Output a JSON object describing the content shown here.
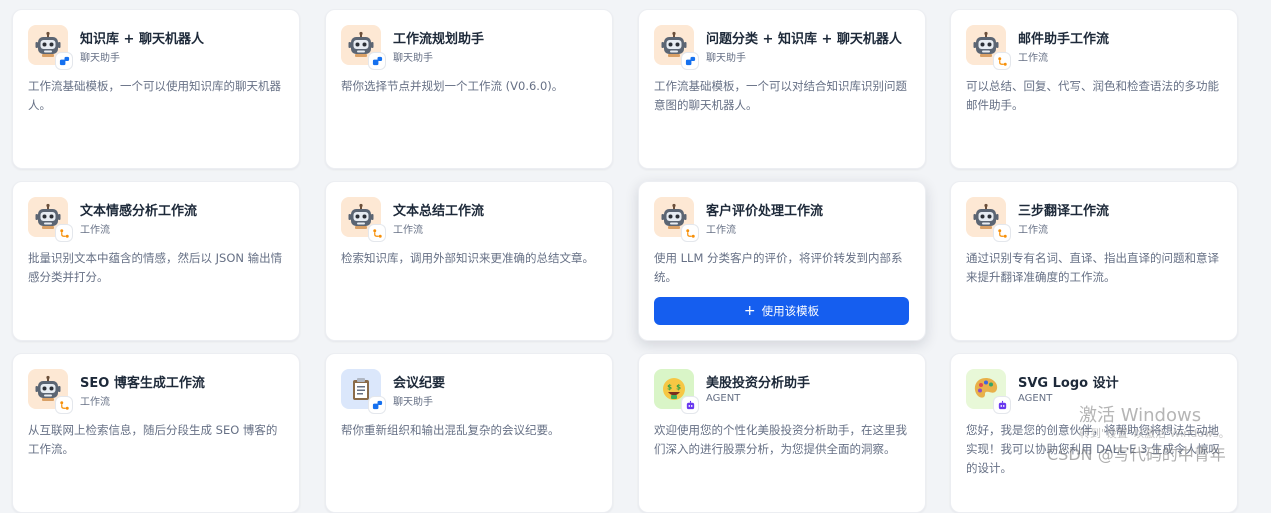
{
  "colors": {
    "page_bg": "#f2f4f7",
    "accent": "#155eef",
    "robot_bg": "#fde8d4",
    "doc_bg": "#dbe7fb",
    "stock_bg": "#d9f5c7",
    "palette_bg": "#e8f8d8"
  },
  "cards": [
    {
      "title": "知识库 + 聊天机器人",
      "subtitle": "聊天助手",
      "desc": "工作流基础模板，一个可以使用知识库的聊天机器人。",
      "icon": "robot-icon",
      "mode_icon": "chat-assistant-icon"
    },
    {
      "title": "工作流规划助手",
      "subtitle": "聊天助手",
      "desc": "帮你选择节点并规划一个工作流 (V0.6.0)。",
      "icon": "robot-icon",
      "mode_icon": "chat-assistant-icon"
    },
    {
      "title": "问题分类 + 知识库 + 聊天机器人",
      "subtitle": "聊天助手",
      "desc": "工作流基础模板，一个可以对结合知识库识别问题意图的聊天机器人。",
      "icon": "robot-icon",
      "mode_icon": "chat-assistant-icon"
    },
    {
      "title": "邮件助手工作流",
      "subtitle": "工作流",
      "desc": "可以总结、回复、代写、润色和检查语法的多功能邮件助手。",
      "icon": "robot-icon",
      "mode_icon": "workflow-icon"
    },
    {
      "title": "文本情感分析工作流",
      "subtitle": "工作流",
      "desc": "批量识别文本中蕴含的情感，然后以 JSON 输出情感分类并打分。",
      "icon": "robot-icon",
      "mode_icon": "workflow-icon"
    },
    {
      "title": "文本总结工作流",
      "subtitle": "工作流",
      "desc": "检索知识库，调用外部知识来更准确的总结文章。",
      "icon": "robot-icon",
      "mode_icon": "workflow-icon"
    },
    {
      "title": "客户评价处理工作流",
      "subtitle": "工作流",
      "desc": "使用 LLM 分类客户的评价，将评价转发到内部系统。",
      "icon": "robot-icon",
      "mode_icon": "workflow-icon",
      "hovered": true,
      "button_label": "使用该模板"
    },
    {
      "title": "三步翻译工作流",
      "subtitle": "工作流",
      "desc": "通过识别专有名词、直译、指出直译的问题和意译来提升翻译准确度的工作流。",
      "icon": "robot-icon",
      "mode_icon": "workflow-icon"
    },
    {
      "title": "SEO 博客生成工作流",
      "subtitle": "工作流",
      "desc": "从互联网上检索信息，随后分段生成 SEO 博客的工作流。",
      "icon": "robot-icon",
      "mode_icon": "workflow-icon"
    },
    {
      "title": "会议纪要",
      "subtitle": "聊天助手",
      "desc": "帮你重新组织和输出混乱复杂的会议纪要。",
      "icon": "clipboard-icon",
      "mode_icon": "chat-assistant-icon"
    },
    {
      "title": "美股投资分析助手",
      "subtitle": "AGENT",
      "desc": "欢迎使用您的个性化美股投资分析助手，在这里我们深入的进行股票分析，为您提供全面的洞察。",
      "icon": "money-face-icon",
      "mode_icon": "agent-icon"
    },
    {
      "title": "SVG Logo 设计",
      "subtitle": "AGENT",
      "desc": "您好，我是您的创意伙伴，将帮助您将想法生动地实现！我可以协助您利用 DALL·E 3 生成令人惊叹的设计。",
      "icon": "palette-icon",
      "mode_icon": "agent-icon"
    }
  ],
  "watermark": {
    "line1": "激活 Windows",
    "line2": "转到\"设置\"以激活 Windows。",
    "csdn": "CSDN @写代码的中青年"
  }
}
